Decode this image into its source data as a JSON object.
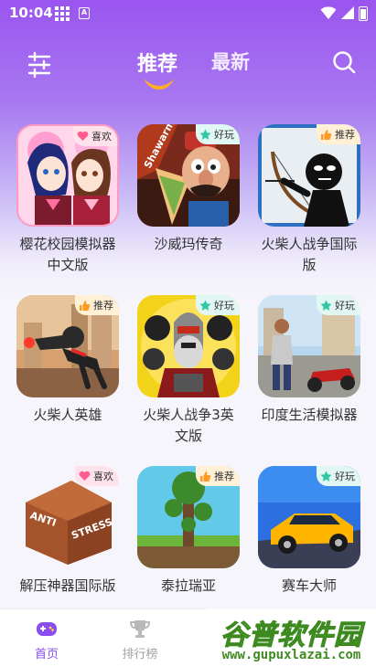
{
  "status_bar": {
    "time": "10:04",
    "a_label": "A"
  },
  "header": {
    "tabs": [
      {
        "label": "推荐",
        "active": true
      },
      {
        "label": "最新",
        "active": false
      }
    ]
  },
  "games": [
    {
      "name": "樱花校园模拟器中文版",
      "badge": "喜欢",
      "badge_icon": "heart-icon"
    },
    {
      "name": "沙威玛传奇",
      "badge": "好玩",
      "badge_icon": "star-icon",
      "thumb_text": "Shawarma"
    },
    {
      "name": "火柴人战争国际版",
      "badge": "推荐",
      "badge_icon": "thumbs-up-icon"
    },
    {
      "name": "火柴人英雄",
      "badge": "推荐",
      "badge_icon": "thumbs-up-icon"
    },
    {
      "name": "火柴人战争3英文版",
      "badge": "好玩",
      "badge_icon": "star-icon"
    },
    {
      "name": "印度生活模拟器",
      "badge": "好玩",
      "badge_icon": "star-icon"
    },
    {
      "name": "解压神器国际版",
      "badge": "喜欢",
      "badge_icon": "heart-icon",
      "thumb_text": [
        "ANTI",
        "STRESS"
      ]
    },
    {
      "name": "泰拉瑞亚",
      "badge": "推荐",
      "badge_icon": "thumbs-up-icon"
    },
    {
      "name": "赛车大师",
      "badge": "好玩",
      "badge_icon": "star-icon"
    }
  ],
  "bottom_nav": [
    {
      "label": "首页",
      "icon": "gamepad-icon",
      "active": true
    },
    {
      "label": "排行榜",
      "icon": "trophy-icon",
      "active": false
    }
  ],
  "watermark": {
    "main": "谷普软件园",
    "url": "www.gupuxlazai.com"
  },
  "colors": {
    "accent": "#8a4ef0",
    "header_top": "#9a55ef",
    "smile": "#ffb020"
  }
}
